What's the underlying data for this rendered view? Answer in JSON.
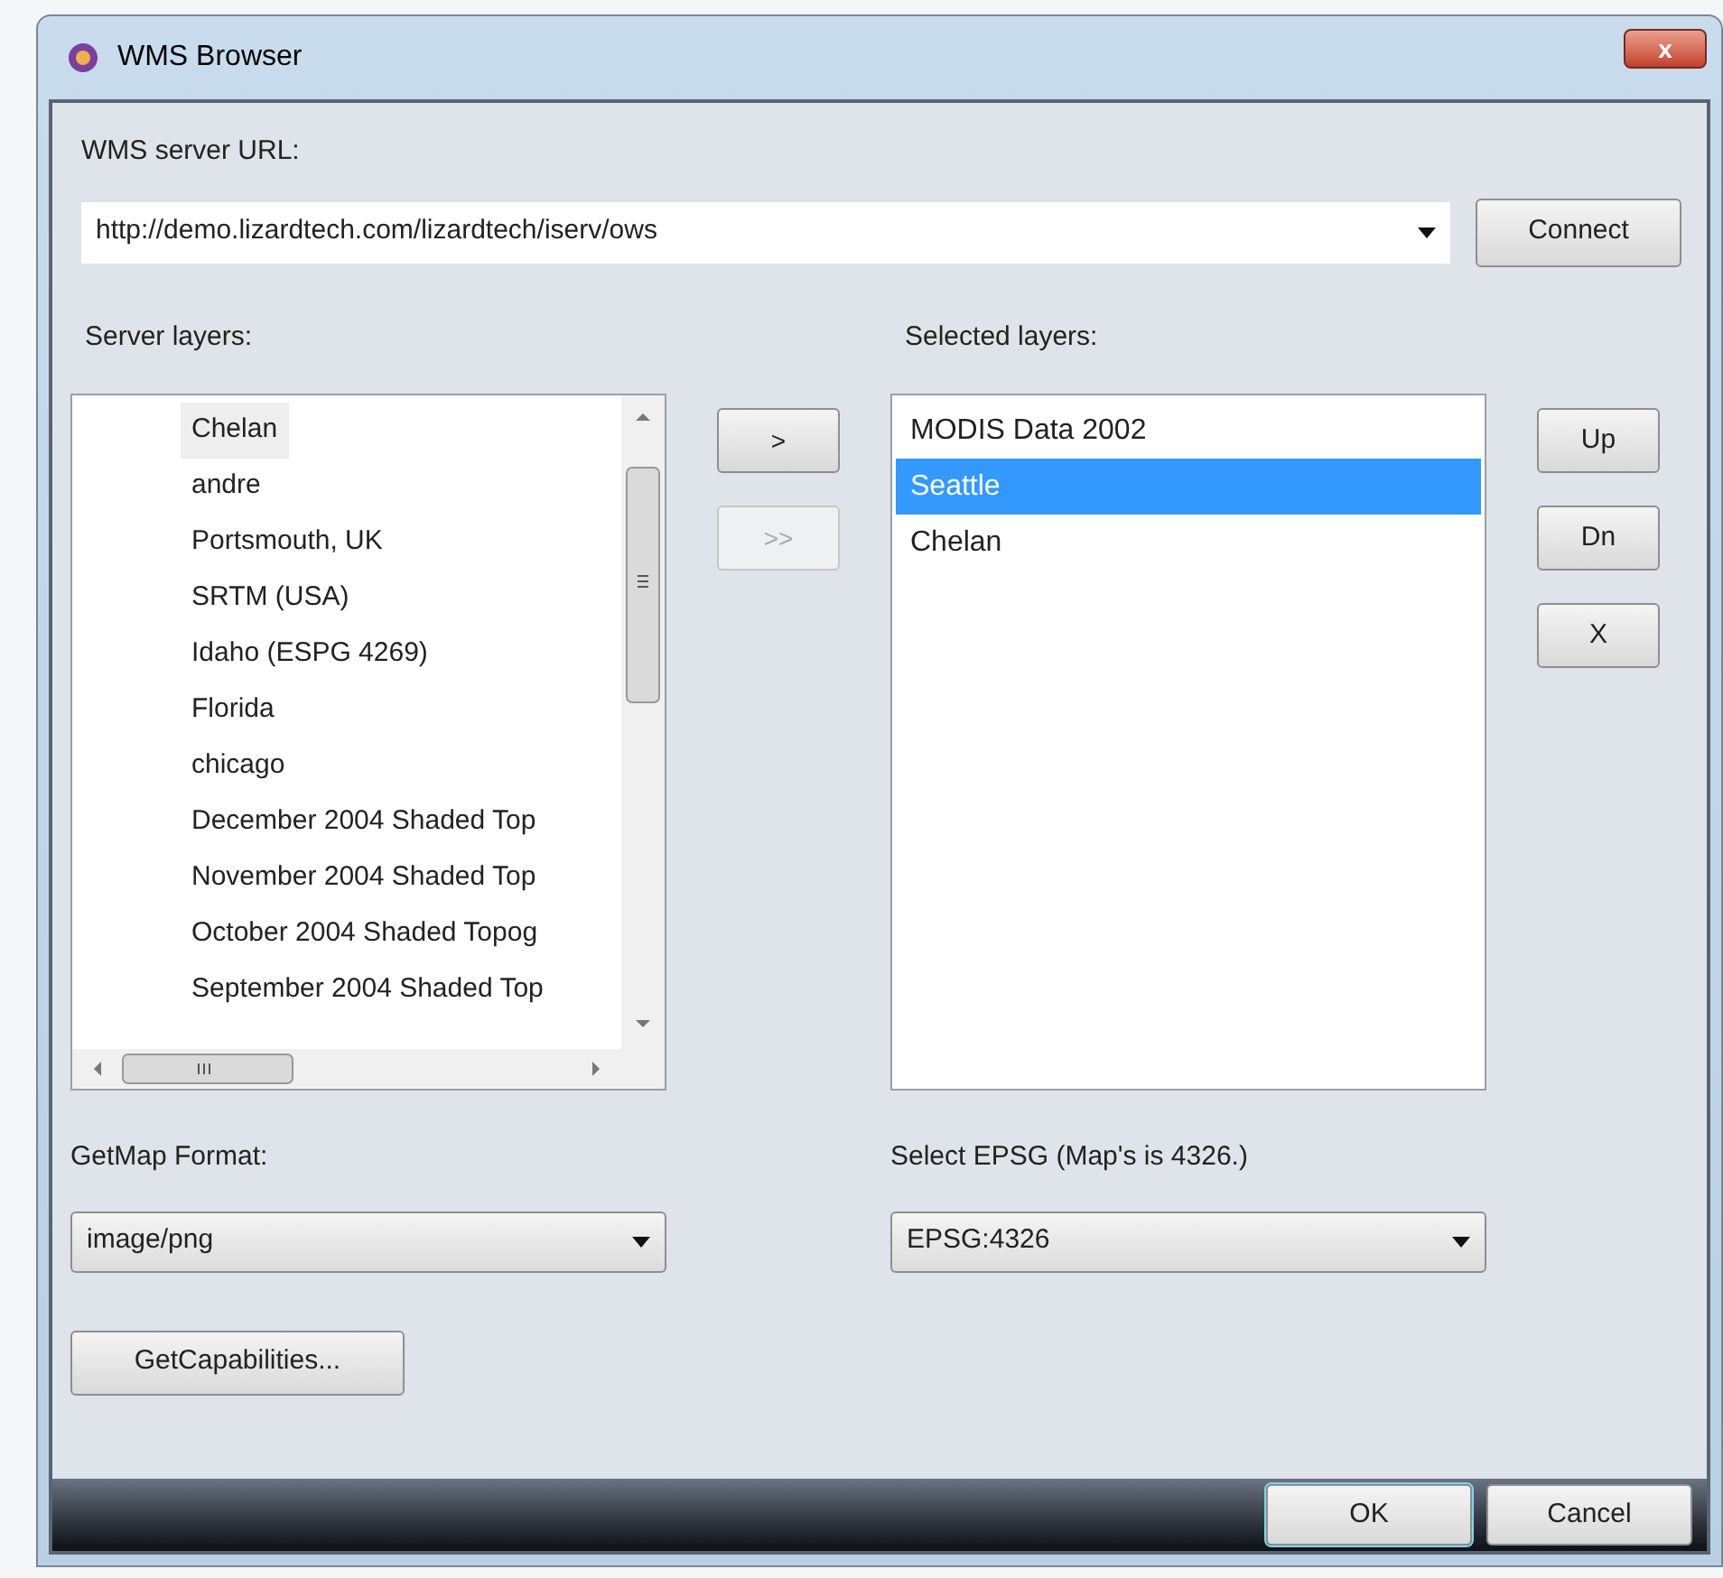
{
  "window": {
    "title": "WMS Browser",
    "close": "x"
  },
  "url": {
    "label": "WMS server URL:",
    "value": "http://demo.lizardtech.com/lizardtech/iserv/ows",
    "button": "Connect"
  },
  "server_layers": {
    "label": "Server layers:",
    "items": [
      {
        "label": "Chelan",
        "selected": true
      },
      {
        "label": "andre",
        "selected": false
      },
      {
        "label": "Portsmouth, UK",
        "selected": false
      },
      {
        "label": "SRTM (USA)",
        "selected": false
      },
      {
        "label": "Idaho (ESPG 4269)",
        "selected": false
      },
      {
        "label": "Florida",
        "selected": false
      },
      {
        "label": "chicago",
        "selected": false
      },
      {
        "label": "December 2004 Shaded Top",
        "selected": false
      },
      {
        "label": "November 2004 Shaded Top",
        "selected": false
      },
      {
        "label": "October 2004 Shaded Topog",
        "selected": false
      },
      {
        "label": "September 2004 Shaded Top",
        "selected": false
      }
    ]
  },
  "move_buttons": [
    {
      "label": ">",
      "disabled": false
    },
    {
      "label": ">>",
      "disabled": true
    }
  ],
  "selected_layers": {
    "label": "Selected layers:",
    "items": [
      {
        "label": "MODIS Data 2002",
        "selected": false
      },
      {
        "label": "Seattle",
        "selected": true
      },
      {
        "label": "Chelan",
        "selected": false
      }
    ]
  },
  "order_buttons": [
    "Up",
    "Dn",
    "X"
  ],
  "getmap_format": {
    "label": "GetMap Format:",
    "value": "image/png"
  },
  "epsg": {
    "label": "Select EPSG (Map's is 4326.)",
    "value": "EPSG:4326"
  },
  "capabilities_button": "GetCapabilities...",
  "footer_buttons": [
    {
      "label": "OK",
      "default": true
    },
    {
      "label": "Cancel",
      "default": false
    }
  ]
}
